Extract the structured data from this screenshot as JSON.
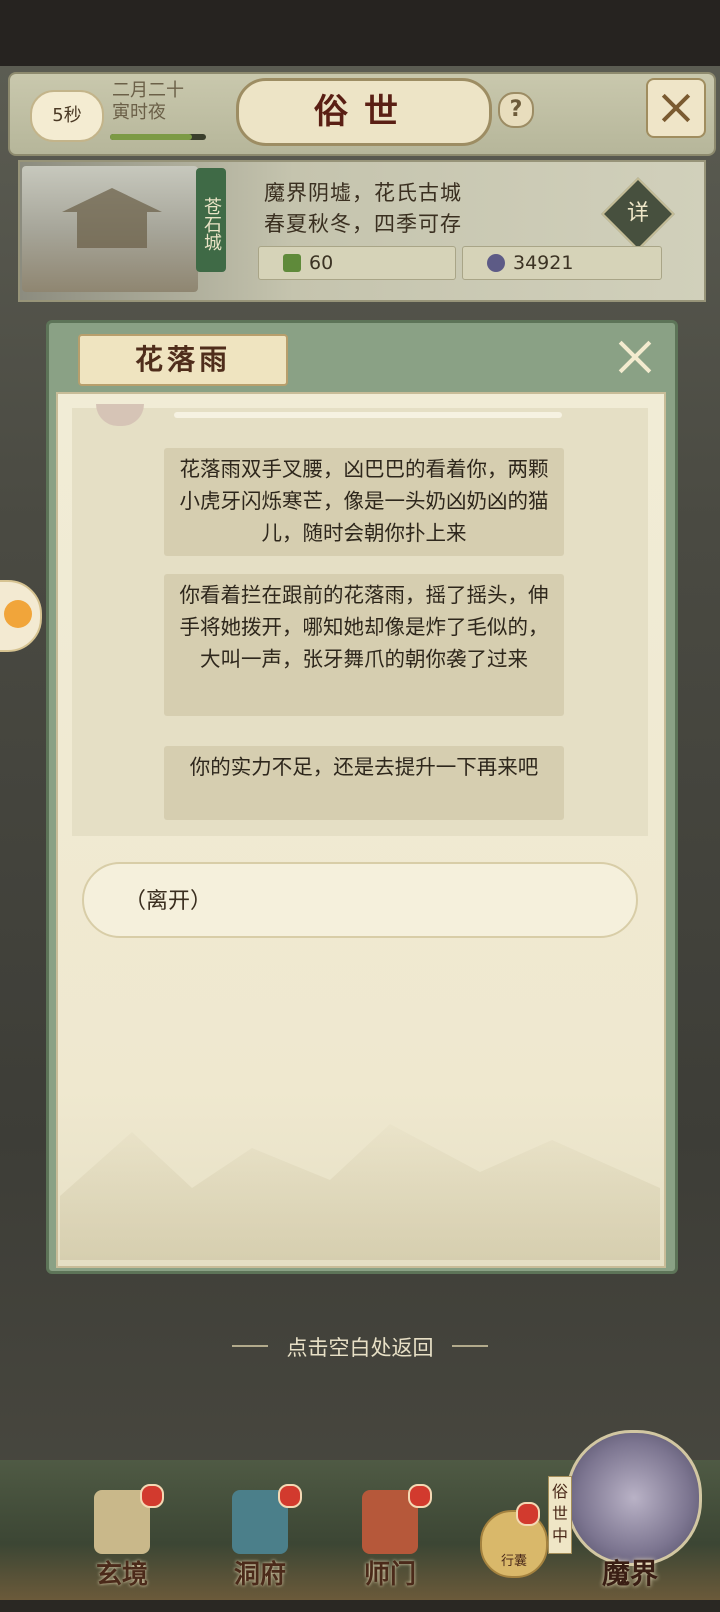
{
  "header": {
    "timer": "5秒",
    "date_line1": "二月二十",
    "date_line2": "寅时夜",
    "time_progress": 0.85,
    "title": "俗世",
    "help": "?"
  },
  "location": {
    "city_name": "苍石城",
    "desc_line1": "魔界阴墟，花氏古城",
    "desc_line2": "春夏秋冬，四季可存",
    "detail_label": "详",
    "resource1": "60",
    "resource2": "34921"
  },
  "dialog": {
    "title": "花落雨",
    "messages": [
      "花落雨双手叉腰，凶巴巴的看着你，两颗小虎牙闪烁寒芒，像是一头奶凶奶凶的猫儿，随时会朝你扑上来",
      "你看着拦在跟前的花落雨，摇了摇头，伸手将她拨开，哪知她却像是炸了毛似的，大叫一声，张牙舞爪的朝你袭了过来",
      "你的实力不足，还是去提升一下再来吧"
    ],
    "option": "（离开）"
  },
  "return_hint": "点击空白处返回",
  "nav": {
    "items": [
      "玄境",
      "洞府",
      "师门"
    ],
    "bag": "行囊",
    "realm_tag": "俗世中",
    "realm_label": "魔界"
  },
  "colors": {
    "accent_green": "#8aa185",
    "title_red": "#5a1f14",
    "badge_red": "#d23a2e"
  }
}
